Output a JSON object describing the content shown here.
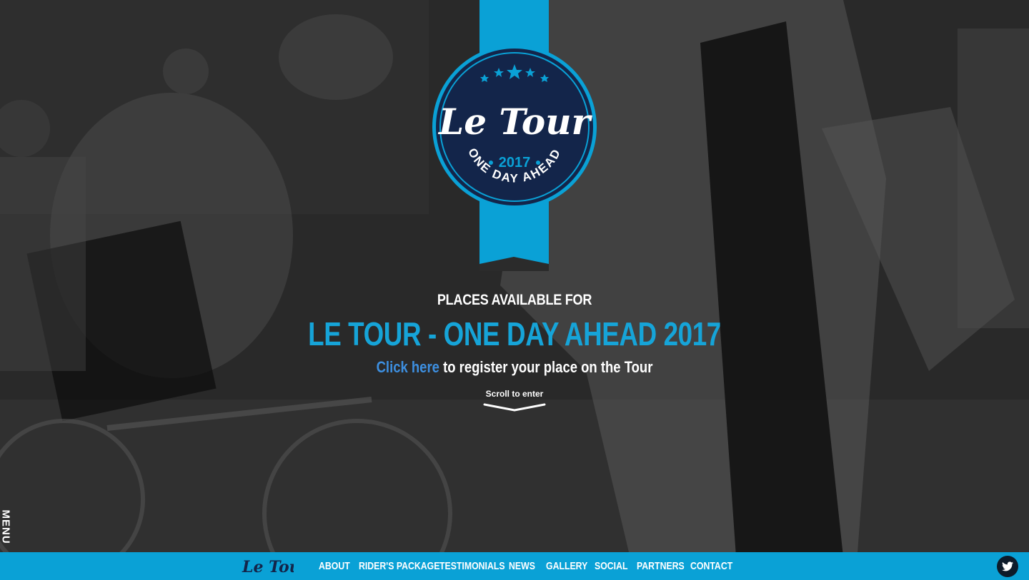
{
  "badge": {
    "script_title": "Le Tour",
    "year": "2017",
    "tagline": "ONE DAY AHEAD"
  },
  "hero": {
    "kicker": "PLACES AVAILABLE FOR",
    "headline": "LE TOUR - ONE DAY AHEAD 2017",
    "cta_link": "Click here",
    "cta_rest": " to register your place on the Tour",
    "scroll_label": "Scroll to enter",
    "side_tab_label": "MENU"
  },
  "nav": {
    "logo_text": "Le Tour",
    "items": [
      {
        "label": "ABOUT"
      },
      {
        "label": "RIDER'S PACKAGE"
      },
      {
        "label": "TESTIMONIALS"
      },
      {
        "label": "NEWS"
      },
      {
        "label": "GALLERY"
      },
      {
        "label": "SOCIAL"
      },
      {
        "label": "PARTNERS"
      },
      {
        "label": "CONTACT"
      }
    ]
  },
  "colors": {
    "brand_blue": "#0aa1d6",
    "headline_blue": "#16a4d8",
    "link_blue": "#3d8fe0",
    "badge_navy": "#13254a"
  },
  "icons": {
    "twitter": "twitter-icon",
    "scroll": "chevron-down-icon",
    "stars": "star-icon"
  }
}
